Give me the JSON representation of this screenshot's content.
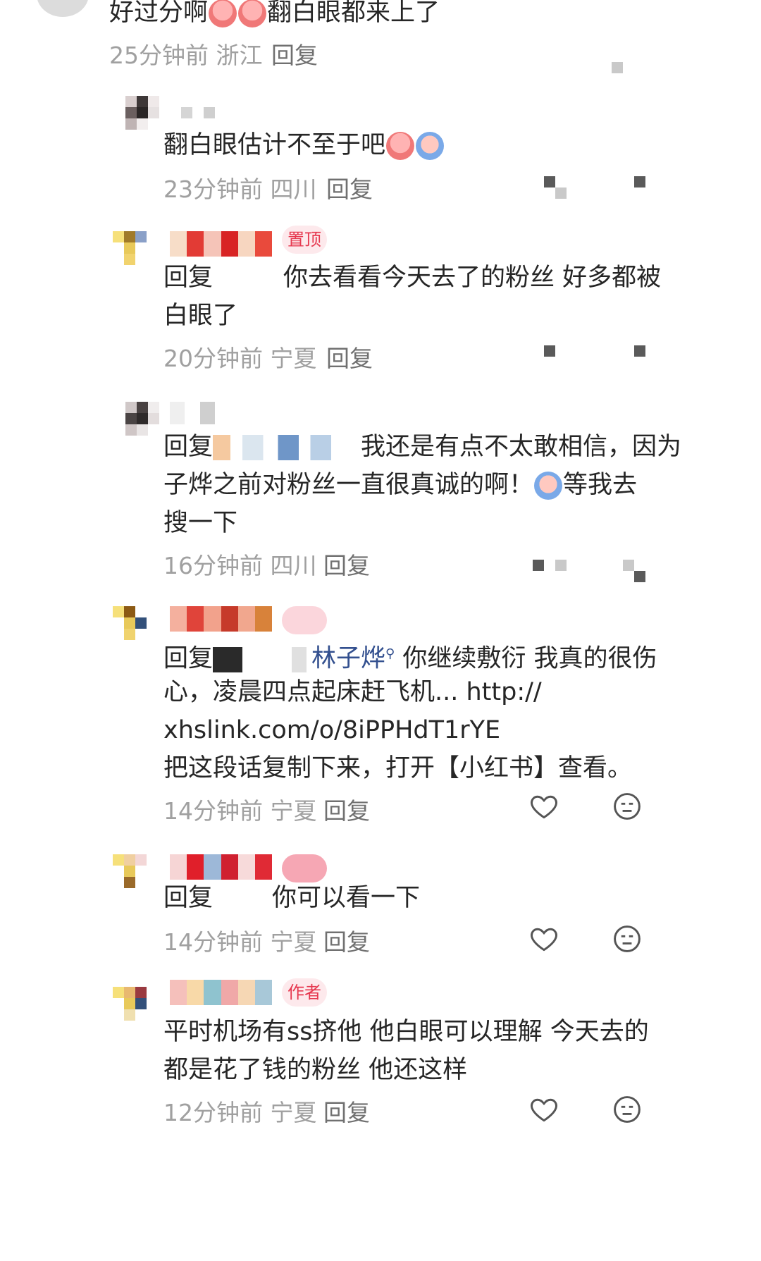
{
  "comments": [
    {
      "text_a": "好过分啊",
      "text_b": "翻白眼都来上了",
      "time": "25分钟前",
      "location": "浙江",
      "reply": "回复"
    },
    {
      "text": "翻白眼估计不至于吧",
      "time": "23分钟前",
      "location": "四川",
      "reply": "回复"
    },
    {
      "line1_prefix": "回复",
      "line1_rest": "你去看看今天去了的粉丝 好多都被",
      "line2": "白眼了",
      "tag": "置顶",
      "time": "20分钟前",
      "location": "宁夏",
      "reply": "回复"
    },
    {
      "line1_prefix": "回复",
      "line1_rest": "我还是有点不太敢相信，因为",
      "line2_a": "子烨之前对粉丝一直很真诚的啊！",
      "line2_b": "等我去",
      "line3": "搜一下",
      "time": "16分钟前",
      "location": "四川",
      "reply": "回复"
    },
    {
      "line1_prefix": "回复",
      "mention": "林子烨",
      "line1_rest": "你继续敷衍 我真的很伤",
      "line2": "心，凌晨四点起床赶飞机... http://",
      "line3": "xhslink.com/o/8iPPHdT1rYE",
      "line4": "把这段话复制下来，打开【小红书】查看。",
      "time": "14分钟前",
      "location": "宁夏",
      "reply": "回复"
    },
    {
      "line1_prefix": "回复",
      "line1_rest": "你可以看一下",
      "time": "14分钟前",
      "location": "宁夏",
      "reply": "回复"
    },
    {
      "tag": "作者",
      "line1": "平时机场有ss挤他 他白眼可以理解 今天去的",
      "line2": "都是花了钱的粉丝 他还这样",
      "time": "12分钟前",
      "location": "宁夏",
      "reply": "回复"
    }
  ],
  "icons": {
    "like": "heart-icon",
    "dislike": "meh-icon"
  }
}
